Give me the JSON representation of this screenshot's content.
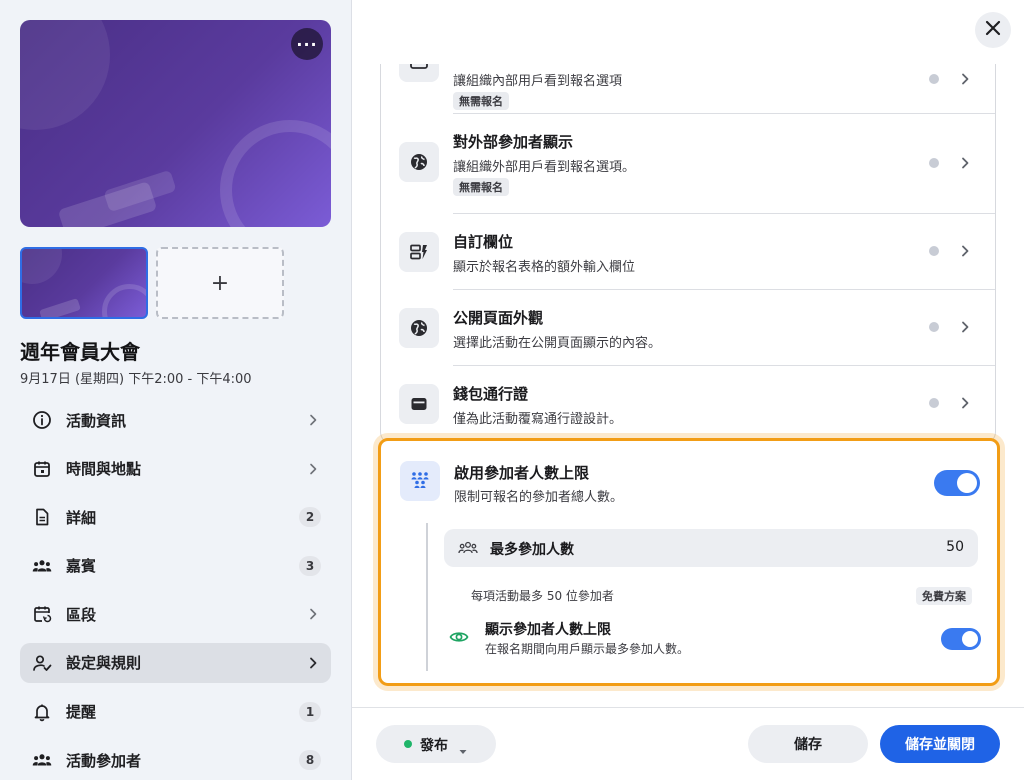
{
  "event": {
    "title": "週年會員大會",
    "date": "9月17日 (星期四) 下午2:00 - 下午4:00",
    "more_glyph": "···",
    "add_glyph": "+"
  },
  "sidebar": {
    "items": [
      {
        "label": "活動資訊",
        "icon": "info-icon"
      },
      {
        "label": "時間與地點",
        "icon": "calendar-icon"
      },
      {
        "label": "詳細",
        "icon": "document-icon",
        "badge": "2"
      },
      {
        "label": "嘉賓",
        "icon": "people-icon",
        "badge": "3"
      },
      {
        "label": "區段",
        "icon": "calendar-repeat-icon"
      },
      {
        "label": "設定與規則",
        "icon": "user-check-icon",
        "active": true
      },
      {
        "label": "提醒",
        "icon": "bell-icon",
        "badge": "1"
      },
      {
        "label": "活動參加者",
        "icon": "people-icon",
        "badge": "8"
      }
    ]
  },
  "settings": {
    "rows": [
      {
        "title": "",
        "desc": "讓組織內部用戶看到報名選項",
        "tag": "無需報名",
        "icon": "badge-icon"
      },
      {
        "title": "對外部參加者顯示",
        "desc": "讓組織外部用戶看到報名選項。",
        "tag": "無需報名",
        "icon": "globe-icon"
      },
      {
        "title": "自訂欄位",
        "desc": "顯示於報名表格的額外輸入欄位",
        "icon": "custom-field-icon"
      },
      {
        "title": "公開頁面外觀",
        "desc": "選擇此活動在公開頁面顯示的內容。",
        "icon": "globe-icon"
      },
      {
        "title": "錢包通行證",
        "desc": "僅為此活動覆寫通行證設計。",
        "icon": "wallet-icon"
      }
    ],
    "capacity": {
      "title": "啟用參加者人數上限",
      "desc": "限制可報名的參加者總人數。",
      "enabled": true,
      "max_label": "最多參加人數",
      "max_value": "50",
      "note": "每項活動最多 50 位參加者",
      "plan_tag": "免費方案",
      "show_title": "顯示參加者人數上限",
      "show_desc": "在報名期間向用戶顯示最多參加人數。",
      "show_enabled": true
    }
  },
  "footer": {
    "publish_label": "發布",
    "save_label": "儲存",
    "save_close_label": "儲存並關閉"
  },
  "colors": {
    "accent": "#1f63e6",
    "toggle_on": "#3a7af0",
    "highlight": "#f29d16",
    "published": "#1fb56a"
  }
}
